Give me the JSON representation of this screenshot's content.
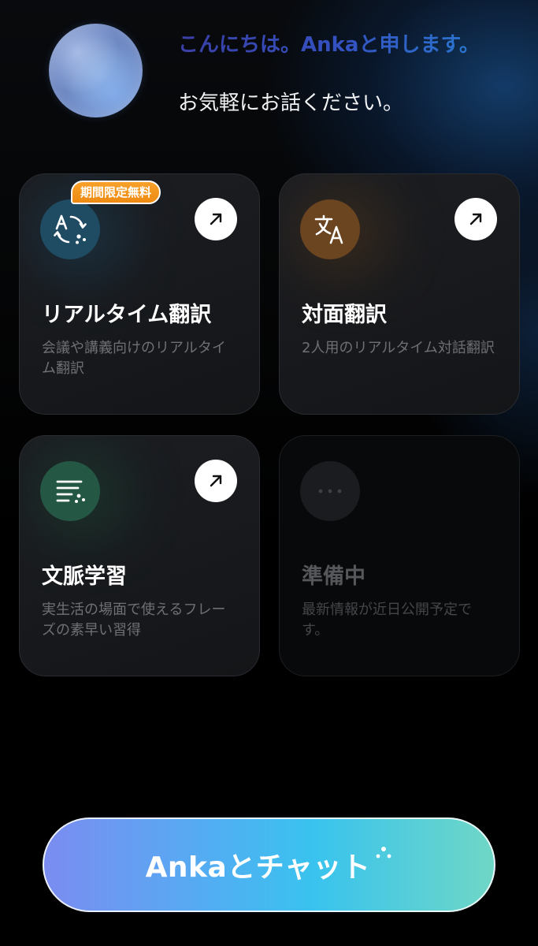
{
  "header": {
    "greeting": "こんにちは。Ankaと申します。",
    "subgreeting": "お気軽にお話ください。"
  },
  "cards": [
    {
      "title": "リアルタイム翻訳",
      "description": "会議や講義向けのリアルタイム翻訳",
      "badge": "期間限定無料",
      "icon": "realtime-translate-icon",
      "accent": "#1f4b63"
    },
    {
      "title": "対面翻訳",
      "description": "2人用のリアルタイム対話翻訳",
      "icon": "translate-icon",
      "accent": "#6b4420"
    },
    {
      "title": "文脈学習",
      "description": "実生活の場面で使えるフレーズの素早い習得",
      "icon": "context-learning-icon",
      "accent": "#255745"
    },
    {
      "title": "準備中",
      "description": "最新情報が近日公開予定です。",
      "icon": "more-icon",
      "accent": "#1b1c1f"
    }
  ],
  "chat_button": {
    "label": "Ankaとチャット"
  }
}
